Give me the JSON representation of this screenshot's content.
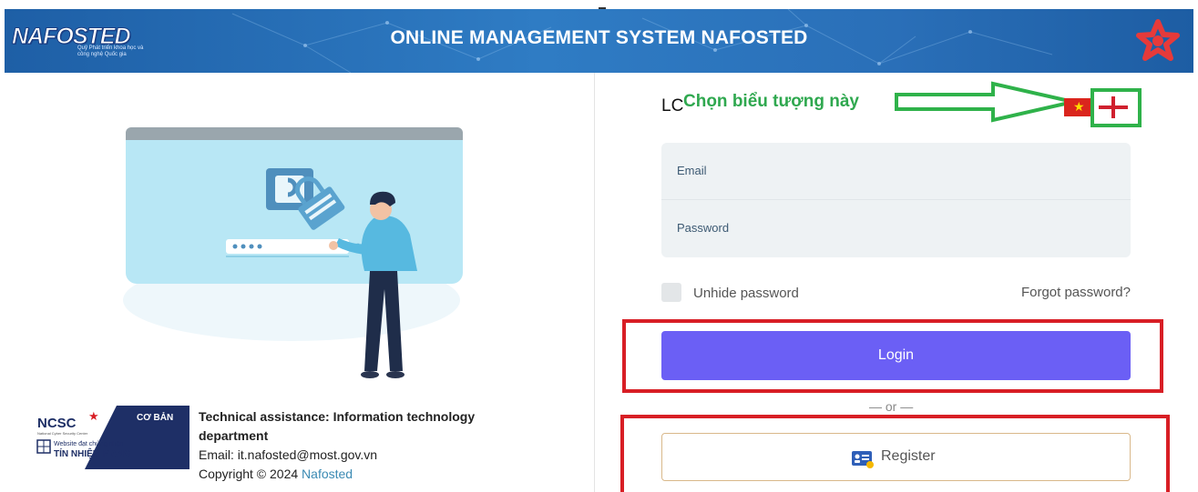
{
  "header": {
    "logo_text": "NAFOSTED",
    "logo_subtext": "Quỹ Phát triển khoa học và công nghệ Quốc gia",
    "title": "ONLINE MANAGEMENT SYSTEM NAFOSTED"
  },
  "login_panel": {
    "lc_label": "LC",
    "annotation_text": "Chọn biểu tượng này",
    "languages": [
      "vi-flag-icon",
      "en-flag-icon"
    ],
    "email_label": "Email",
    "password_label": "Password",
    "unhide_label": "Unhide password",
    "forgot_label": "Forgot password?",
    "login_label": "Login",
    "or_label": "— or —",
    "register_label": "Register"
  },
  "footer": {
    "badge": {
      "org": "NCSC",
      "org_sub": "National Cyber Security Center",
      "level": "CƠ BẢN",
      "line1": "Website đạt chứng nhận",
      "line2": "TÍN NHIỆM MẠNG"
    },
    "tech_title": "Technical assistance: Information technology department",
    "email_line": "Email: it.nafosted@most.gov.vn",
    "copyright_prefix": "Copyright © 2024",
    "copyright_brand": "Nafosted"
  },
  "colors": {
    "header_blue": "#2f7cc4",
    "login_purple": "#6b5ff5",
    "annotation_green": "#2fa84f",
    "highlight_red": "#d81e25"
  }
}
